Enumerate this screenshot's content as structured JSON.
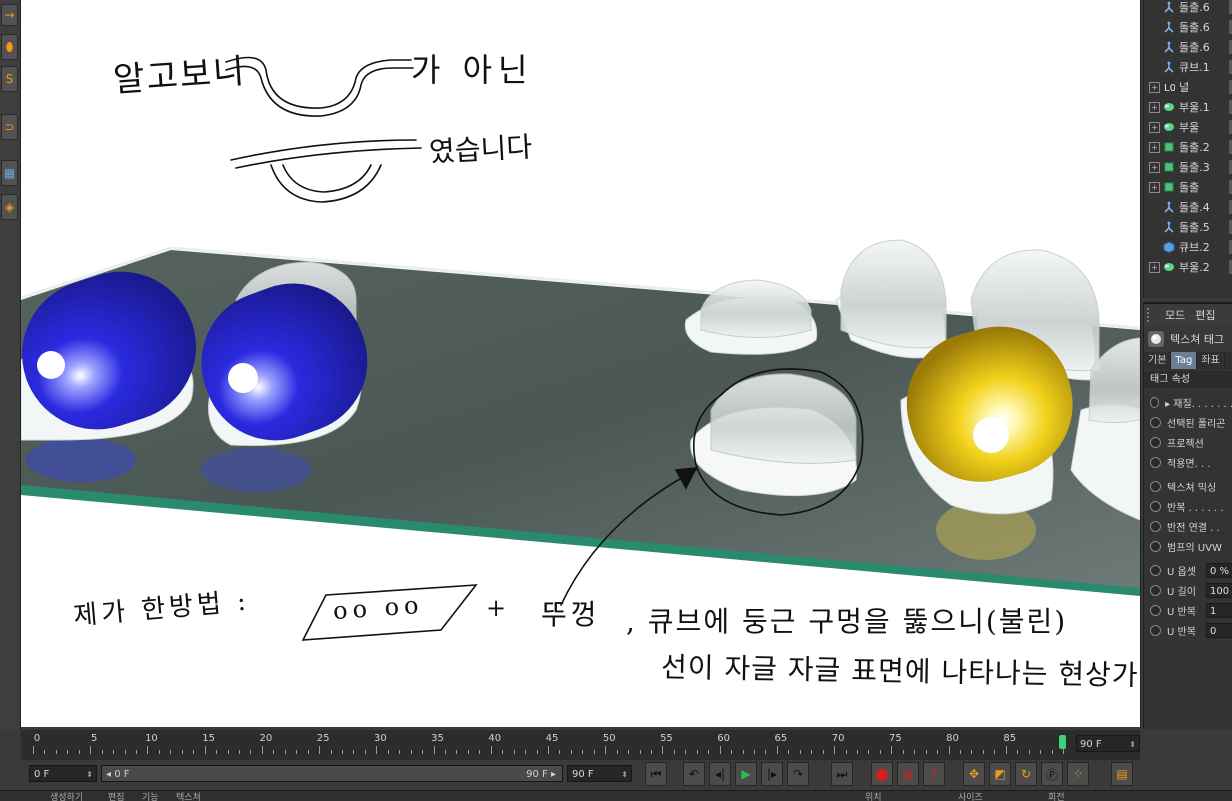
{
  "objects": [
    {
      "label": "돌출.6",
      "icon": "spline-icon",
      "expand": false
    },
    {
      "label": "돌출.6",
      "icon": "spline-icon",
      "expand": false
    },
    {
      "label": "돌출.6",
      "icon": "spline-icon",
      "expand": false
    },
    {
      "label": "큐브.1",
      "icon": "spline-icon",
      "expand": false
    },
    {
      "label": "널",
      "icon": "null-icon",
      "expand": true
    },
    {
      "label": "부울.1",
      "icon": "boole-icon",
      "expand": true
    },
    {
      "label": "부울",
      "icon": "boole-icon",
      "expand": true
    },
    {
      "label": "돌출.2",
      "icon": "extrude-icon",
      "expand": true
    },
    {
      "label": "돌출.3",
      "icon": "extrude-icon",
      "expand": true
    },
    {
      "label": "돌출",
      "icon": "extrude-icon",
      "expand": true
    },
    {
      "label": "돌출.4",
      "icon": "spline-icon",
      "expand": false
    },
    {
      "label": "돌출.5",
      "icon": "spline-icon",
      "expand": false
    },
    {
      "label": "큐브.2",
      "icon": "cube-icon",
      "expand": false
    },
    {
      "label": "부울.2",
      "icon": "boole-icon",
      "expand": true
    }
  ],
  "attributes": {
    "menu": [
      "모드",
      "편집"
    ],
    "header_title": "텍스쳐 태그",
    "tabs": [
      "기본",
      "Tag",
      "좌표"
    ],
    "section": "태그 속성",
    "rows": [
      {
        "label": "▸ 재질. . . . . . .",
        "value": ""
      },
      {
        "label": "선택된 폴리곤",
        "value": ""
      },
      {
        "label": "프로젝션",
        "value": ""
      },
      {
        "label": "적용면. . .",
        "value": ""
      },
      {
        "label": "텍스쳐 믹싱",
        "value": ""
      },
      {
        "label": "반복 . . . . . .",
        "value": ""
      },
      {
        "label": "반전 연결 . .",
        "value": ""
      },
      {
        "label": "범프의 UVW",
        "value": ""
      },
      {
        "label": "U 옵셋",
        "value": "0 %"
      },
      {
        "label": "U 길이",
        "value": "100"
      },
      {
        "label": "U 반복",
        "value": "1"
      },
      {
        "label": "U 반복",
        "value": "0"
      }
    ]
  },
  "timeline": {
    "ticks": [
      "0",
      "5",
      "10",
      "15",
      "20",
      "25",
      "30",
      "35",
      "40",
      "45",
      "50",
      "55",
      "60",
      "65",
      "70",
      "75",
      "80",
      "85"
    ],
    "current_frame": 90,
    "max_frame": 90,
    "end_field": "90 F"
  },
  "transport": {
    "start_field": "0 F",
    "range_start": "◂ 0 F",
    "range_end": "90 F ▸",
    "end_field": "90 F"
  },
  "annotations": {
    "line1_a": "알고보니",
    "line1_b": "가 아닌",
    "line2": "였습니다",
    "method_prefix": "제가 한방법 :",
    "method_shape": "oo oo",
    "method_plus": "+",
    "method_suffix": "뚜껑",
    "note_line1": ", 큐브에 둥근 구멍을 뚫으니(불린)",
    "note_line2": "선이 자글 자글 표면에 나타나는 현상가지"
  },
  "bottom_tabs": [
    "생성하기",
    "편집",
    "기능",
    "텍스쳐",
    "위치",
    "사이즈",
    "회전"
  ],
  "colors": {
    "viewport_bg": "#ffffff",
    "glass_plate": "#4a5a57",
    "plate_edge": "#2a8a6e",
    "capsule_blue": "#2a2ae0",
    "capsule_yellow": "#f2d21a",
    "tab_active": "#6b7e93",
    "playhead": "#3fd07a",
    "ui_orange": "#f29a1c"
  }
}
